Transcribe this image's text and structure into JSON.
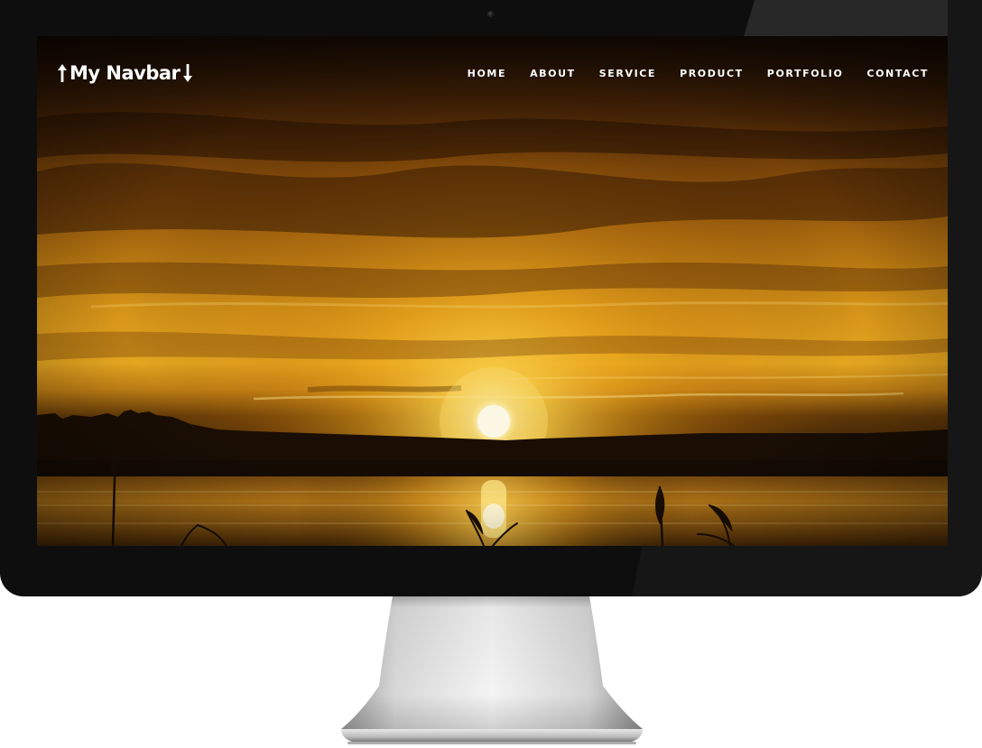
{
  "navbar": {
    "brand": "My Navbar",
    "brand_left_icon": "arrow-up-icon",
    "brand_right_icon": "arrow-down-icon",
    "items": [
      {
        "label": "HOME"
      },
      {
        "label": "ABOUT"
      },
      {
        "label": "SERVICE"
      },
      {
        "label": "PRODUCT"
      },
      {
        "label": "PORTFOLIO"
      },
      {
        "label": "CONTACT"
      }
    ]
  },
  "hero": {
    "image": "sunset-over-lake"
  },
  "colors": {
    "bezel": "#0e0e0e",
    "nav_text": "#ffffff",
    "sun": "#fff6c0",
    "sky_glow": "#f2b01e"
  }
}
